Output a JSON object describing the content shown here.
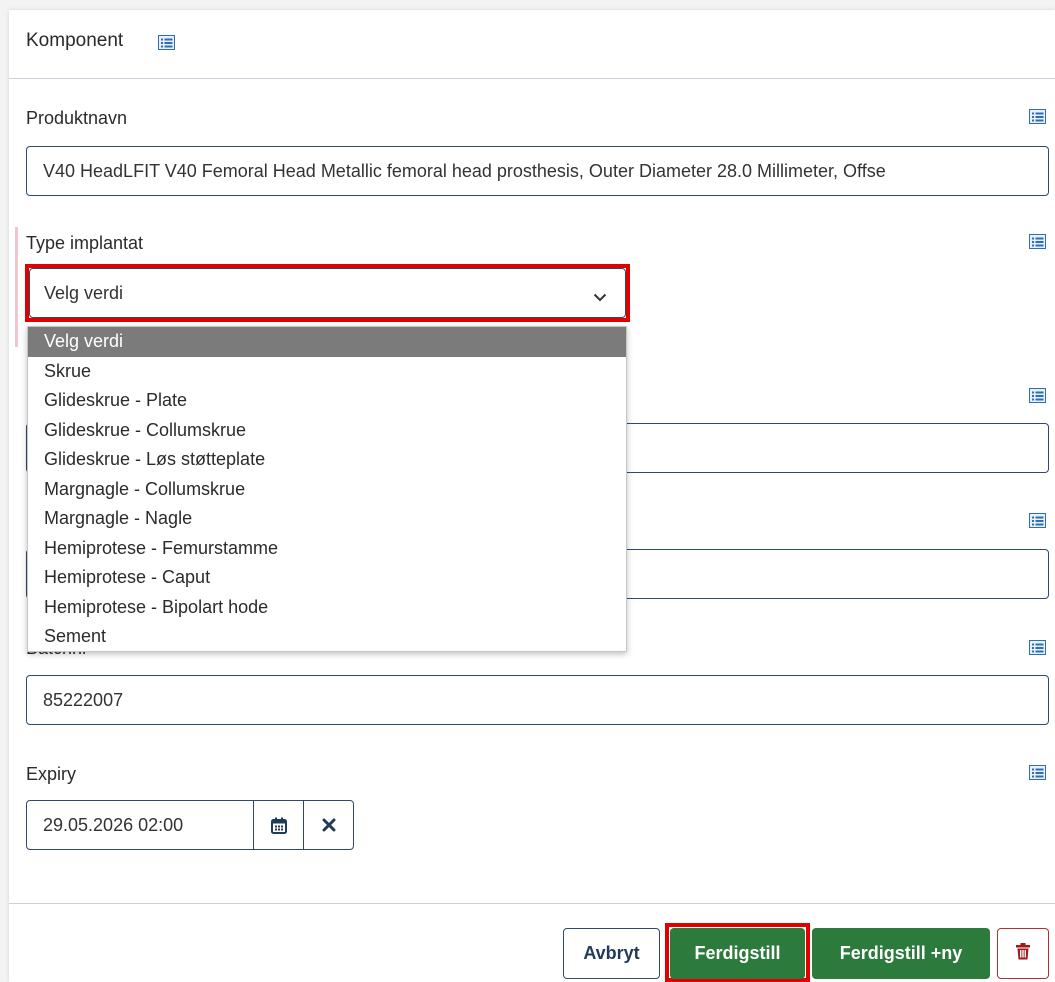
{
  "header": {
    "title": "Komponent"
  },
  "fields": {
    "produktnavn": {
      "label": "Produktnavn",
      "value": "V40 HeadLFIT V40 Femoral Head  Metallic femoral head prosthesis, Outer Diameter 28.0 Millimeter, Offse"
    },
    "type_implantat": {
      "label": "Type implantat",
      "selected": "Velg verdi",
      "options": [
        "Velg verdi",
        "Skrue",
        "Glideskrue - Plate",
        "Glideskrue - Collumskrue",
        "Glideskrue - Løs støtteplate",
        "Margnagle - Collumskrue",
        "Margnagle - Nagle",
        "Hemiprotese - Femurstamme",
        "Hemiprotese - Caput",
        "Hemiprotese - Bipolart hode",
        "Sement"
      ]
    },
    "field_3": {
      "value": ""
    },
    "field_4": {
      "value": ""
    },
    "batchnr": {
      "label": "Batchnr",
      "value": "85222007"
    },
    "expiry": {
      "label": "Expiry",
      "value": "29.05.2026 02:00"
    }
  },
  "buttons": {
    "cancel": "Avbryt",
    "finish": "Ferdigstill",
    "finish_new": "Ferdigstill +ny"
  },
  "icons": {
    "field_info": "list-icon",
    "calendar": "calendar-icon",
    "clear": "close-icon",
    "chevron": "chevron-down-icon",
    "delete": "trash-icon"
  },
  "colors": {
    "primary_green": "#2d7b3c",
    "border_navy": "#2e4a6b",
    "highlight_red": "#e00000",
    "icon_blue": "#2f6db5"
  }
}
